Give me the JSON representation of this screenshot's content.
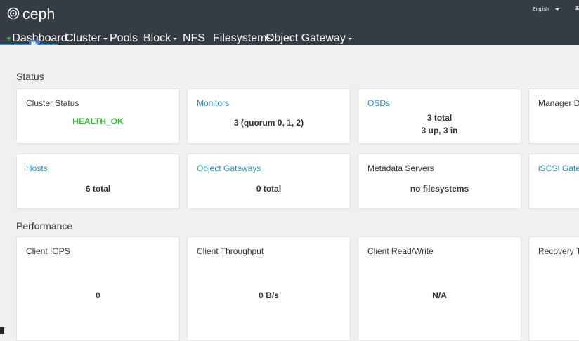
{
  "brand": {
    "name": "ceph",
    "logo_icon": "ceph-logo-icon"
  },
  "header": {
    "language": "English"
  },
  "nav": {
    "items": [
      {
        "label": "Dashboard",
        "active": true
      },
      {
        "label": "Cluster",
        "dropdown": true
      },
      {
        "label": "Pools"
      },
      {
        "label": "Block",
        "dropdown": true
      },
      {
        "label": "NFS"
      },
      {
        "label": "Filesystems"
      },
      {
        "label": "Object Gateway",
        "dropdown": true
      }
    ]
  },
  "sections": {
    "status": "Status",
    "performance": "Performance"
  },
  "status_cards": [
    {
      "title": "Cluster Status",
      "value": "HEALTH_OK",
      "link": false
    },
    {
      "title": "Monitors",
      "value": "3 (quorum 0, 1, 2)",
      "link": true
    },
    {
      "title": "OSDs",
      "value_line1": "3 total",
      "value_line2": "3 up, 3 in",
      "link": true
    },
    {
      "title": "Manager D",
      "link": false
    },
    {
      "title": "Hosts",
      "value": "6 total",
      "link": true
    },
    {
      "title": "Object Gateways",
      "value": "0 total",
      "link": true
    },
    {
      "title": "Metadata Servers",
      "value": "no filesystems",
      "link": false
    },
    {
      "title": "iSCSI Gate",
      "link": true
    }
  ],
  "performance_cards": [
    {
      "title": "Client IOPS",
      "value": "0"
    },
    {
      "title": "Client Throughput",
      "value": "0 B/s"
    },
    {
      "title": "Client Read/Write",
      "value": "N/A"
    },
    {
      "title": "Recovery T"
    }
  ],
  "colors": {
    "navbar": "#353c44",
    "background": "#f0f0f0",
    "link": "#2a8fbd",
    "health_ok": "#2db82d",
    "active_underline": "#3d8dbc"
  }
}
